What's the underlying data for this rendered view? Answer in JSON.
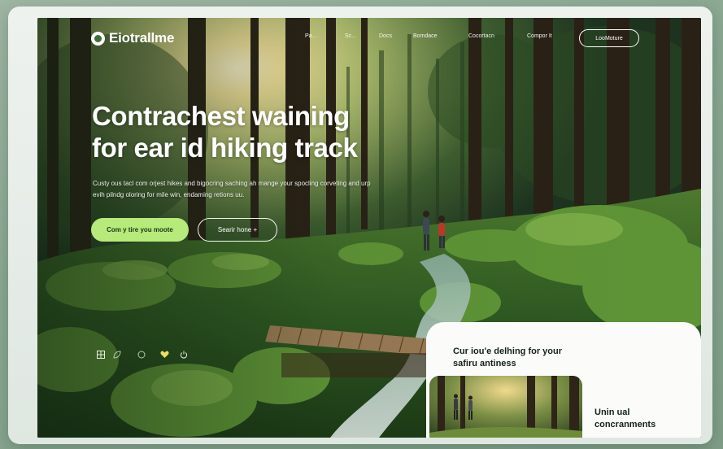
{
  "nav": {
    "brand": "Eiotrallme",
    "links": [
      "Pa...",
      "Sc...",
      "Docs",
      "Bomdace",
      "Cocortacn",
      "Compor It"
    ],
    "cta": "LooMoture"
  },
  "hero": {
    "title_line1": "Contrachest waining",
    "title_line2": "for ear id hiking track",
    "body": "Custy ous tacl com orjest hikes and bigocring saching ah mange your spocling corveting and urp evih pilndg oloring for mile win, endaming retions uu.",
    "primary_button": "Com y tire you moote",
    "secondary_button": "Searir hone +"
  },
  "icons": [
    "grid-icon",
    "leaf-icon",
    "circle-icon",
    "heart-icon",
    "power-icon"
  ],
  "card": {
    "title": "Cur iou'e delhing for your safiru antiness",
    "subtitle": "Unin ual concranments"
  },
  "colors": {
    "accent": "#b6ea7a",
    "forest_dark": "#213a24",
    "card_bg": "#fbfcfa"
  }
}
